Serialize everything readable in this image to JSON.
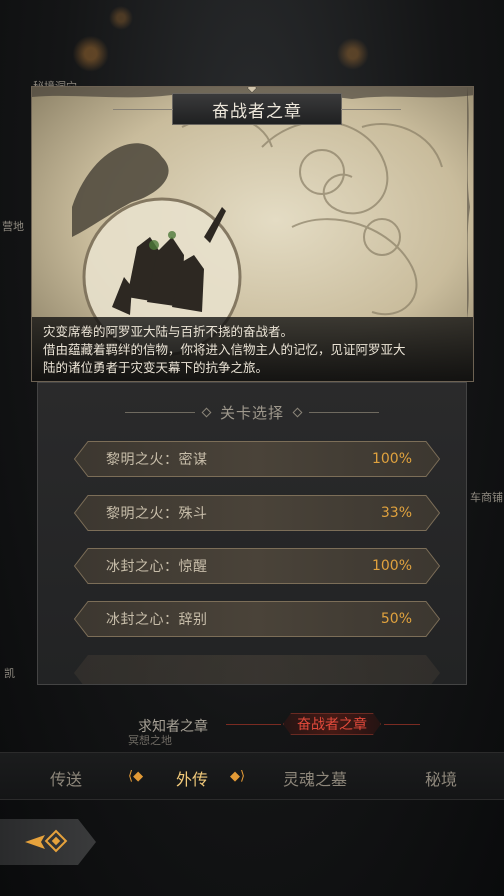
{
  "background": {
    "labels": [
      "秘境洞穴",
      "营地",
      "凯",
      "车商铺",
      "冥想之地"
    ]
  },
  "card": {
    "title": "奋战者之章",
    "description": [
      "灾变席卷的阿罗亚大陆与百折不挠的奋战者。",
      "借由蕴藏着羁绊的信物，你将进入信物主人的记忆，见证阿罗亚大",
      "陆的诸位勇者于灾变天幕下的抗争之旅。"
    ]
  },
  "stage_select": {
    "header": "关卡选择",
    "stages": [
      {
        "name": "黎明之火：密谋",
        "progress": "100%"
      },
      {
        "name": "黎明之火：殊斗",
        "progress": "33%"
      },
      {
        "name": "冰封之心：惊醒",
        "progress": "100%"
      },
      {
        "name": "冰封之心：辞别",
        "progress": "50%"
      }
    ]
  },
  "chapters": {
    "left": "求知者之章",
    "active": "奋战者之章"
  },
  "tabs": [
    {
      "label": "传送",
      "active": false
    },
    {
      "label": "外传",
      "active": true
    },
    {
      "label": "灵魂之墓",
      "active": false
    },
    {
      "label": "秘境",
      "active": false
    }
  ],
  "colors": {
    "progress": "#e0a23e",
    "active_chapter": "#e24a3b",
    "active_tab": "#f1c97a"
  }
}
